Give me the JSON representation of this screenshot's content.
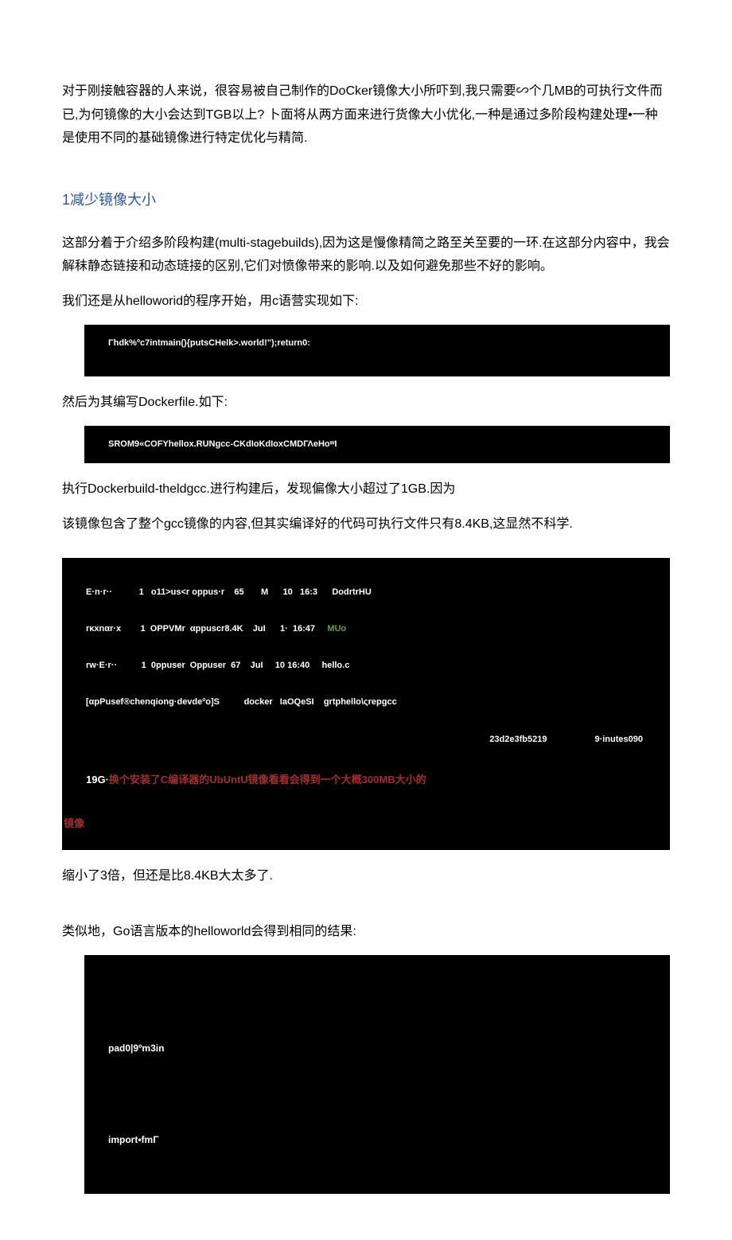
{
  "intro": "对于刚接触容器的人来说，很容易被自己制作的DoCker镜像大小所吓到,我只需要∽个几MB的可执行文件而已,为何镜像的大小会达到TGB以上?   卜面将从两方面来进行货像大小优化,一种是通过多阶段构建处理•一种是使用不同的基础镜像进行特定优化与精简.",
  "h2_1": "1减少镜像大小",
  "p1": "这部分着于介绍多阶段构建(multi-stagebuilds),因为这是慢像精简之路至关至要的一环.在这部分内容中，我会解秣静态链接和动态琏接的区别,它们对愤像带来的影响.以及如何避免那些不好的影响。",
  "p2": "我们还是从helloworid的程序开始，用c语营实现如下:",
  "code1": "Γhdk%ºc7intmain(){putsCHelk>.world!\");return0:",
  "p3": "然后为其编写Dockerfile.如下:",
  "code2": "SROM9«COFYhellox.RUNgcc-CKdIoKdIoxCMDΓΛeHoʷI",
  "p4": "执行Dockerbuild-theldgcc.进行构建后，发现偏像大小超过了1GB.因为",
  "p5": "该镜像包含了整个gcc镜像的内容,但其实编译好的代码可执行文件只有8.4KB,这显然不科学.",
  "code3": {
    "l1a": "E·n·r··           1   o11>us<r oppus·r    65       M      10   16:3      DodrtrHU",
    "l1b": "rκxnαr·x        1  OPPVMr  αppuscr8.4K    JuI      1·  16:47     ",
    "l1b_green": "MUo",
    "l1c": "rw·E·r··          1  0ppuser  Oppuser  67    JuI     10 16:40     hello.c",
    "l1d": "[αpPusef®chenqiong·devdeºo]S          docker   IaOQeSI    grtphello\\ςrepgcc",
    "l1e_right1": "23d2e3fb5219",
    "l1e_right2": "9·inutes090",
    "l2a": "19G·",
    "l2b_red": "换个安装了C编译器的UbUntU镜像看看会得到一个大概300MB大小的",
    "l3_red": "镜像"
  },
  "p6": "缩小了3倍，但还是比8.4KB大太多了.",
  "p7": "类似地，Go语言版本的helloworld会得到相同的结果:",
  "code4": {
    "l1": "pad0|9ºm3in",
    "l2": "import•fmΓ"
  }
}
